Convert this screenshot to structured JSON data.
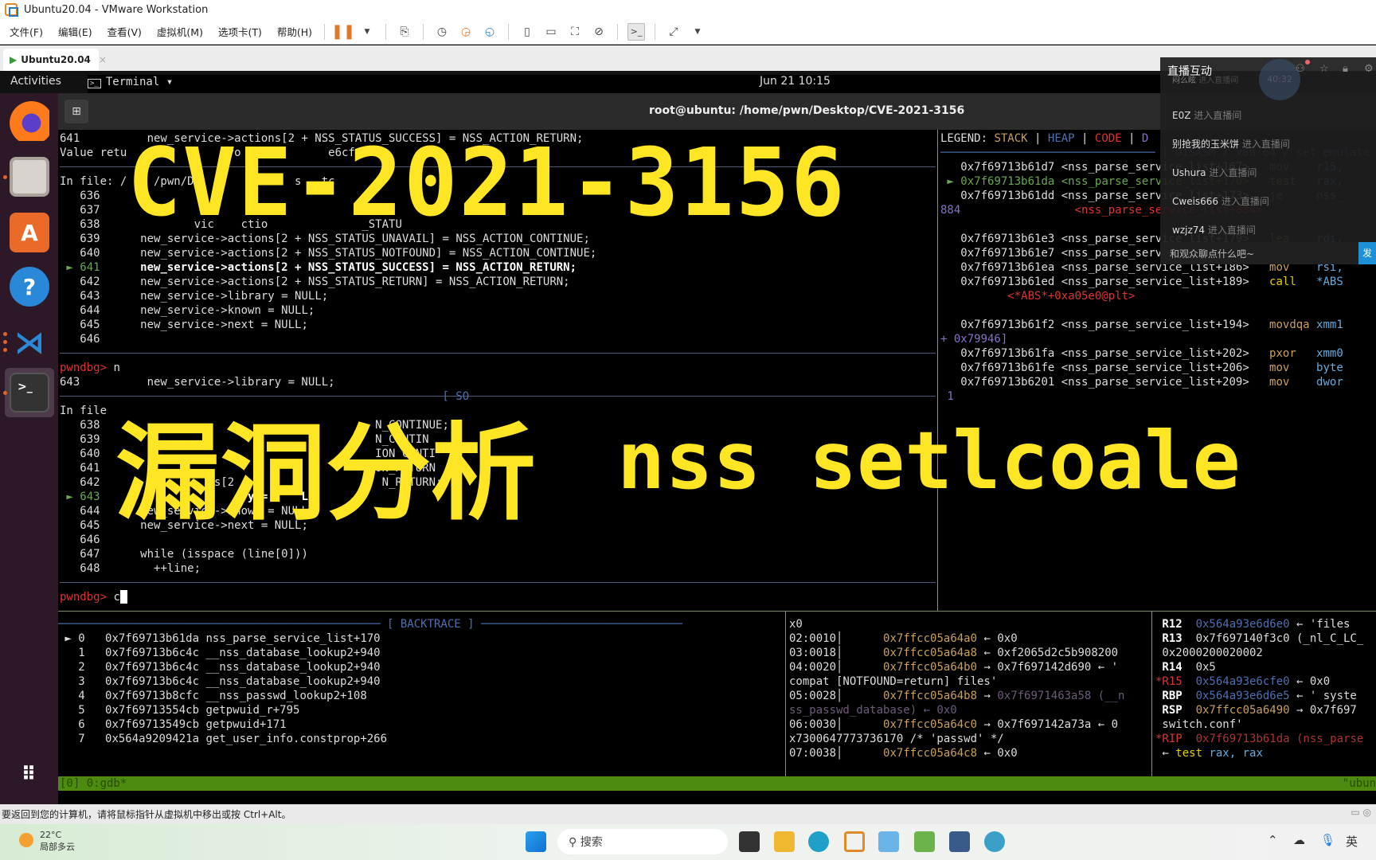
{
  "window": {
    "title": "Ubuntu20.04 - VMware Workstation"
  },
  "menu": [
    "文件(F)",
    "编辑(E)",
    "查看(V)",
    "虚拟机(M)",
    "选项卡(T)",
    "帮助(H)"
  ],
  "vm_tab": {
    "label": "Ubuntu20.04",
    "close": "×"
  },
  "ubuntu_bar": {
    "activities": "Activities",
    "app": "Terminal ▾",
    "clock": "Jun 21  10:15"
  },
  "terminal": {
    "title": "root@ubuntu: /home/pwn/Desktop/CVE-2021-3156",
    "source1": {
      "header1": "641          new_service->actions[2 + NSS_STATUS_SUCCESS] = NSS_ACTION_RETURN;",
      "header2": "Value retu              (vo             e6cfe0",
      "infile": "In file: /    /pwn/De              s   tc",
      "lines": [
        {
          "n": "636",
          "code": ""
        },
        {
          "n": "637",
          "code": "         de     ac"
        },
        {
          "n": "638",
          "code": "        vic    ctio              _STATU"
        },
        {
          "n": "639",
          "code": "new_service->actions[2 + NSS_STATUS_UNAVAIL] = NSS_ACTION_CONTINUE;"
        },
        {
          "n": "640",
          "code": "new_service->actions[2 + NSS_STATUS_NOTFOUND] = NSS_ACTION_CONTINUE;"
        },
        {
          "n": "641",
          "code": "new_service->actions[2 + NSS_STATUS_SUCCESS] = NSS_ACTION_RETURN;",
          "current": true
        },
        {
          "n": "642",
          "code": "new_service->actions[2 + NSS_STATUS_RETURN] = NSS_ACTION_RETURN;"
        },
        {
          "n": "643",
          "code": "new_service->library = NULL;"
        },
        {
          "n": "644",
          "code": "new_service->known = NULL;"
        },
        {
          "n": "645",
          "code": "new_service->next = NULL;"
        },
        {
          "n": "646",
          "code": ""
        }
      ]
    },
    "prompt1": {
      "prompt": "pwndbg>",
      "cmd": " n"
    },
    "step_line": "643          new_service->library = NULL;",
    "source_label": "[ SO",
    "source2": {
      "infile": "In file",
      "lines": [
        {
          "n": "638",
          "code": "                                   N_CONTINUE;"
        },
        {
          "n": "639",
          "code": "                                   N_CONTIN"
        },
        {
          "n": "640",
          "code": "                                   ION_CONTI"
        },
        {
          "n": "641",
          "code": "                                   ON_RETURN"
        },
        {
          "n": "642",
          "code": "          ns[2                      N_RETURN;"
        },
        {
          "n": "643",
          "code": "               ry =     L,",
          "current": true
        },
        {
          "n": "644",
          "code": "new_service->known = NULL;"
        },
        {
          "n": "645",
          "code": "new_service->next = NULL;"
        },
        {
          "n": "646",
          "code": ""
        },
        {
          "n": "647",
          "code": "while (isspace (line[0]))"
        },
        {
          "n": "648",
          "code": "  ++line;"
        }
      ]
    },
    "prompt2": {
      "prompt": "pwndbg>",
      "cmd": " c"
    },
    "backtrace": {
      "label": "[ BACKTRACE ]",
      "frames": [
        {
          "i": "0",
          "addr": "0x7f69713b61da",
          "sym": "nss_parse_service_list+170",
          "current": true
        },
        {
          "i": "1",
          "addr": "0x7f69713b6c4c",
          "sym": "__nss_database_lookup2+940"
        },
        {
          "i": "2",
          "addr": "0x7f69713b6c4c",
          "sym": "__nss_database_lookup2+940"
        },
        {
          "i": "3",
          "addr": "0x7f69713b6c4c",
          "sym": "__nss_database_lookup2+940"
        },
        {
          "i": "4",
          "addr": "0x7f69713b8cfc",
          "sym": "__nss_passwd_lookup2+108"
        },
        {
          "i": "5",
          "addr": "0x7f69713554cb",
          "sym": "getpwuid_r+795"
        },
        {
          "i": "6",
          "addr": "0x7f69713549cb",
          "sym": "getpwuid+171"
        },
        {
          "i": "7",
          "addr": "0x564a9209421a",
          "sym": "get_user_info.constprop+266"
        }
      ]
    },
    "stack": [
      {
        "t": "x0"
      },
      {
        "off": "02:0010",
        "addr": "0x7ffcc05a64a0",
        "arrow": " ← ",
        "val": "0x0"
      },
      {
        "off": "03:0018",
        "addr": "0x7ffcc05a64a8",
        "arrow": " ← ",
        "val": "0xf2065d2c5b908200"
      },
      {
        "off": "04:0020",
        "addr": "0x7ffcc05a64b0",
        "arrow": " → ",
        "val": "0x7f697142d690 ← '"
      },
      {
        "t": "compat [NOTFOUND=return] files'"
      },
      {
        "off": "05:0028",
        "addr": "0x7ffcc05a64b8",
        "arrow": " → ",
        "val": "0x7f6971463a58 (__n",
        "dim": true
      },
      {
        "t": "ss_passwd_database) ← 0x0",
        "dim": true
      },
      {
        "off": "06:0030",
        "addr": "0x7ffcc05a64c0",
        "arrow": " → ",
        "val": "0x7f697142a73a ← 0"
      },
      {
        "t": "x7300647773736170 /* 'passwd' */"
      },
      {
        "off": "07:0038",
        "addr": "0x7ffcc05a64c8",
        "arrow": " ← ",
        "val": "0x0"
      }
    ],
    "registers": [
      {
        "name": "R12",
        "val": "0x564a93e6d6e0",
        "rest": " ← 'files",
        "vc": "b"
      },
      {
        "name": "R13",
        "val": "0x7f697140f3c0",
        "rest": " (_nl_C_LC_",
        "vc": "plain"
      },
      {
        "raw": "0x2000200020002"
      },
      {
        "name": "R14",
        "val": "0x5",
        "rest": "",
        "vc": "plain"
      },
      {
        "name": "*R15",
        "val": "0x564a93e6cfe0",
        "rest": " ← 0x0",
        "vc": "b",
        "changed": true
      },
      {
        "name": "RBP",
        "val": "0x564a93e6d6e5",
        "rest": " ← ' syste",
        "vc": "b"
      },
      {
        "name": "RSP",
        "val": "0x7ffcc05a6490",
        "rest": " → 0x7f697",
        "vc": "o"
      },
      {
        "raw": "switch.conf'"
      },
      {
        "name": "*RIP",
        "val": "0x7f69713b61da",
        "rest": " (nss_parse",
        "vc": "dr",
        "changed": true
      },
      {
        "raw": "← test rax, rax",
        "instr": true
      }
    ],
    "legend": {
      "label": "LEGEND:",
      "stack": "STACK",
      "heap": "HEAP",
      "code": "CODE",
      "data": "D"
    },
    "disasm": {
      "label": "[ DISASM / x86-64 / set emulate on ]",
      "lines": [
        {
          "addr": "0x7f69713b61d7",
          "sym": "<nss_parse_service_list+167>",
          "op": "mov",
          "args": "r15,"
        },
        {
          "addr": "0x7f69713b61da",
          "sym": "<nss_parse_service_list+170>",
          "op": "test",
          "args": "rax,",
          "current": true
        },
        {
          "addr": "0x7f69713b61dd",
          "sym": "<nss_parse_service_list+173>",
          "op": "je",
          "args": "nss_"
        },
        {
          "pre": "884",
          "sub": "<nss_parse_service_list+884>"
        },
        {
          "blank": true
        },
        {
          "addr": "0x7f69713b61e3",
          "sym": "<nss_parse_service_list+179>",
          "op": "lea",
          "args": "rdi,"
        },
        {
          "addr": "0x7f69713b61e7",
          "sym": "<nss_parse_service_list+183>",
          "op": "",
          "args": ""
        },
        {
          "addr": "0x7f69713b61ea",
          "sym": "<nss_parse_service_list+186>",
          "op": "mov",
          "args": "rsi,"
        },
        {
          "addr": "0x7f69713b61ed",
          "sym": "<nss_parse_service_list+189>",
          "op": "call",
          "args": "*ABS",
          "call": true
        },
        {
          "sub2": "<*ABS*+0xa05e0@plt>"
        },
        {
          "blank": true
        },
        {
          "addr": "0x7f69713b61f2",
          "sym": "<nss_parse_service_list+194>",
          "op": "movdqa",
          "args": "xmm1"
        },
        {
          "pre2": "+ 0x79946]"
        },
        {
          "addr": "0x7f69713b61fa",
          "sym": "<nss_parse_service_list+202>",
          "op": "pxor",
          "args": "xmm0"
        },
        {
          "addr": "0x7f69713b61fe",
          "sym": "<nss_parse_service_list+206>",
          "op": "mov",
          "args": "byte"
        },
        {
          "addr": "0x7f69713b6201",
          "sym": "<nss_parse_service_list+209>",
          "op": "mov",
          "args": "dwor"
        },
        {
          "pre3": "1"
        }
      ]
    },
    "tmux": {
      "left": "[0] 0:gdb*",
      "right": "\"ubun"
    }
  },
  "overlay": {
    "line1": "CVE-2021-3156",
    "line2a": "漏洞分析",
    "line2b": "nss setlcoale",
    "color": "#ffe624"
  },
  "live_panel": {
    "title": "直播互动",
    "badge_count": "40:32",
    "entries": [
      {
        "name": "闷么眩",
        "action": "进入直播间"
      },
      {
        "name": "E0Z",
        "action": "进入直播间"
      },
      {
        "name": "别抢我的玉米饼",
        "action": "进入直播间"
      },
      {
        "name": "Ushura",
        "action": "进入直播间"
      },
      {
        "name": "Cweis666",
        "action": "进入直播间"
      },
      {
        "name": "wzjz74",
        "action": "进入直播间"
      }
    ],
    "chat_placeholder": "和观众聊点什么吧~",
    "send_label": "发"
  },
  "vm_status": "要返回到您的计算机，请将鼠标指针从虚拟机中移出或按 Ctrl+Alt。",
  "taskbar": {
    "temp": "22°C",
    "weather": "局部多云",
    "search": "搜索",
    "ime": "英"
  }
}
